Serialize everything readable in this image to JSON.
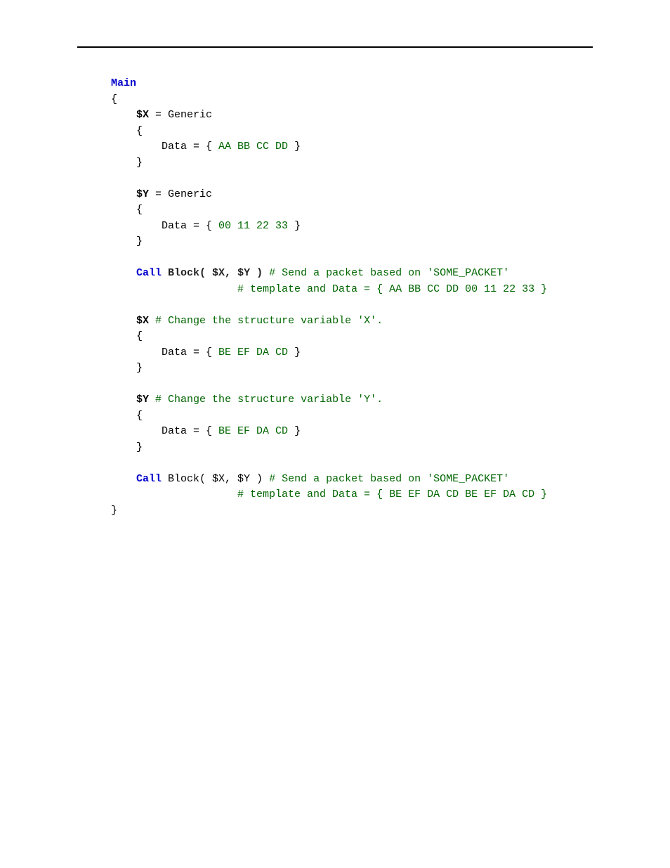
{
  "code": {
    "main_kw": "Main",
    "open_brace": "{",
    "close_brace": "}",
    "generic": "Generic",
    "data_eq": "Data = ",
    "call_kw": "Call",
    "block_call_bold": "Block( $X, $Y )",
    "block_call_plain": " Block( $X, $Y ) ",
    "varX": "$X",
    "varY": "$Y",
    "lit_aa": "AA BB CC DD",
    "lit_00": "00 11 22 33",
    "lit_be1": "BE EF DA CD",
    "lit_be2": "BE EF DA CD",
    "cmt_send1a": "# Send a packet based on 'SOME_PACKET'",
    "cmt_send1b": "# template and Data = { AA BB CC DD 00 11 22 33 }",
    "cmt_changeX": "# Change the structure variable 'X'.",
    "cmt_changeY": "# Change the structure variable 'Y'.",
    "cmt_send2a": "# Send a packet based on 'SOME_PACKET'",
    "cmt_send2b": "# template and Data = { BE EF DA CD BE EF DA CD }",
    "ind1": "    ",
    "ind2": "        ",
    "call_pad": "                    "
  }
}
